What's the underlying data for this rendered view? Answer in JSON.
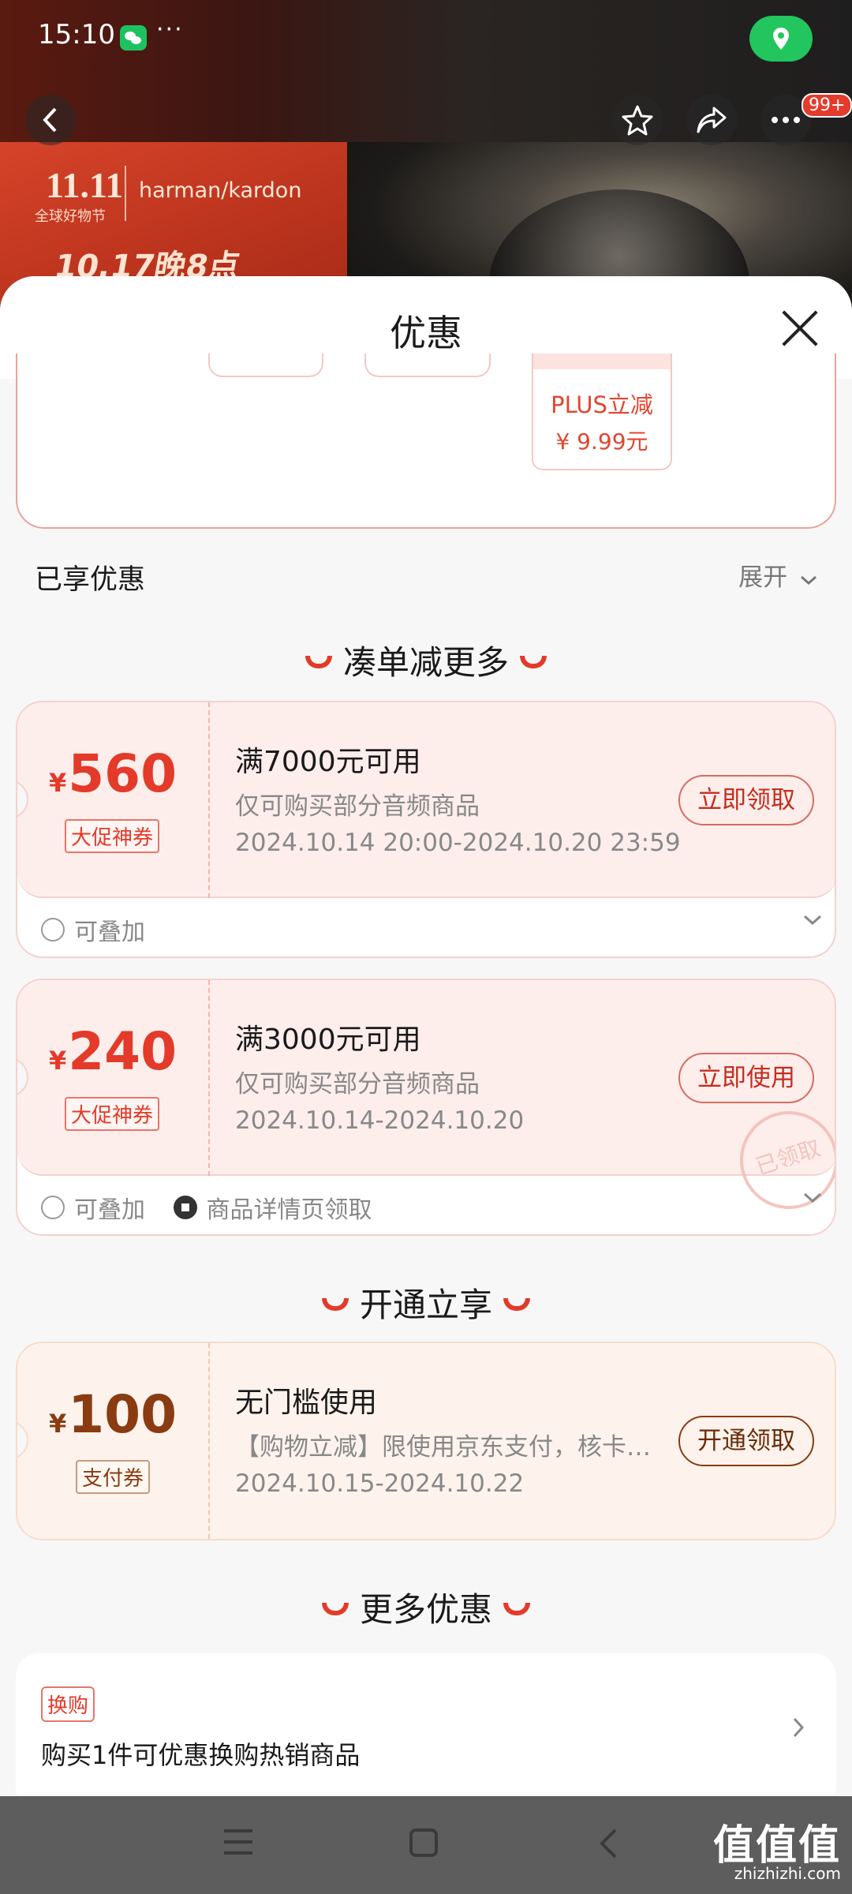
{
  "status_bar": {
    "time": "15:10",
    "more": "···"
  },
  "header": {
    "badge": "99+"
  },
  "banner": {
    "event": "11.11",
    "event_sub": "全球好物节",
    "brand": "harman/kardon",
    "promo": "10.17晚8点"
  },
  "sheet": {
    "title": "优惠"
  },
  "plus_offer": {
    "label": "PLUS立减",
    "price": "¥ 9.99元"
  },
  "enjoyed": {
    "label": "已享优惠",
    "expand": "展开"
  },
  "sections": {
    "combine": "凑单减更多",
    "membership": "开通立享",
    "more": "更多优惠"
  },
  "coupons": [
    {
      "yen": "¥",
      "amount": "560",
      "tag": "大促神券",
      "title": "满7000元可用",
      "desc": "仅可购买部分音频商品",
      "date": "2024.10.14 20:00-2024.10.20 23:59",
      "button": "立即领取",
      "foot": [
        "可叠加"
      ]
    },
    {
      "yen": "¥",
      "amount": "240",
      "tag": "大促神券",
      "title": "满3000元可用",
      "desc": "仅可购买部分音频商品",
      "date": "2024.10.14-2024.10.20",
      "button": "立即使用",
      "foot": [
        "可叠加",
        "商品详情页领取"
      ],
      "stamp": "已领取"
    },
    {
      "yen": "¥",
      "amount": "100",
      "tag": "支付券",
      "title": "无门槛使用",
      "desc": "【购物立减】限使用京东支付，核卡…",
      "date": "2024.10.15-2024.10.22",
      "button": "开通领取"
    }
  ],
  "more_offer": {
    "tag": "换购",
    "text": "购买1件可优惠换购热销商品"
  },
  "watermark": {
    "logo": "值值值",
    "url": "zhizhizhi.com"
  },
  "colors": {
    "accent": "#e33a2a",
    "coupon_bg": "#fdeeec",
    "pay_coupon_text": "#8a3b12"
  },
  "icons": [
    "wechat-icon",
    "location-icon",
    "back-icon",
    "star-icon",
    "share-icon",
    "more-icon",
    "close-icon",
    "chevron-down-icon",
    "chevron-right-icon",
    "stack-icon",
    "ticket-icon",
    "menu-icon",
    "home-icon"
  ]
}
